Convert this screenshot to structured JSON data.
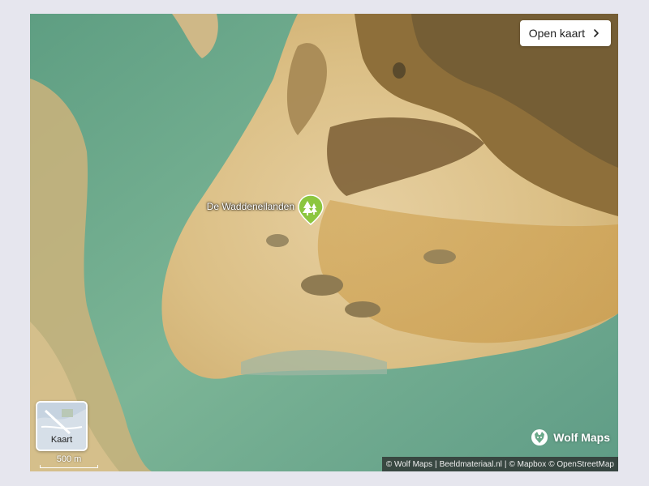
{
  "map": {
    "open_button_label": "Open kaart",
    "marker_label": "De Waddeneilanden",
    "marker_icon": "tree-icon",
    "layer_button_label": "Kaart",
    "scale_label": "500 m",
    "brand_name": "Wolf Maps",
    "attribution": {
      "wolf_maps": "© Wolf Maps",
      "sep1": "|",
      "beeldmateriaal": "Beeldmateriaal.nl",
      "sep2": "|",
      "mapbox": "© Mapbox",
      "osm": "© OpenStreetMap"
    },
    "colors": {
      "water": "#6aa98a",
      "sand": "#e3c994",
      "marker": "#8cc63f"
    }
  }
}
